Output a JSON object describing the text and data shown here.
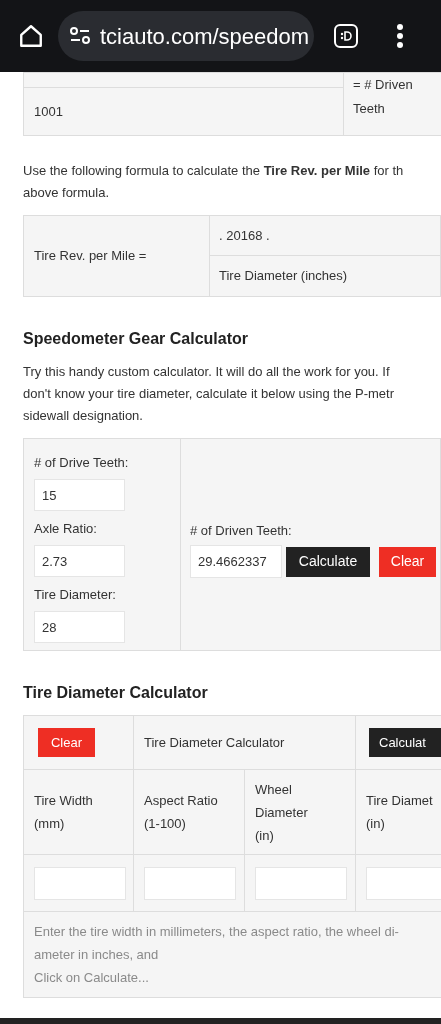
{
  "browser": {
    "url": "tciauto.com/speedom"
  },
  "top_table": {
    "value": "1001",
    "formula_part": "= # Driven Teeth"
  },
  "formula_intro": [
    "Use the following formula to calculate the **Tire Rev. per Mile** for th",
    "above formula."
  ],
  "formula_table": {
    "label": "Tire Rev. per Mile =",
    "numerator": ". 20168 .",
    "denominator": "Tire Diameter (inches)"
  },
  "speedometer": {
    "heading": "Speedometer Gear Calculator",
    "intro": [
      "Try this handy custom calculator. It will do all the work for you. If",
      "don't know your tire diameter, calculate it below using the P-metr",
      "sidewall designation."
    ],
    "fields": [
      {
        "label": "# of Drive Teeth:",
        "value": "15"
      },
      {
        "label": "Axle Ratio:",
        "value": "2.73"
      },
      {
        "label": "Tire Diameter:",
        "value": "28"
      }
    ],
    "result": {
      "label": "# of Driven Teeth:",
      "value": "29.4662337"
    },
    "buttons": [
      {
        "kind": "dark",
        "label": "Calculate"
      },
      {
        "kind": "red",
        "label": "Clear"
      }
    ]
  },
  "tire_calculator": {
    "heading": "Tire Diameter Calculator",
    "clear_button": "Clear",
    "caption": "Tire Diameter Calculator",
    "calculate_button": "Calculat",
    "columns": [
      [
        "Tire Width",
        "(mm)"
      ],
      [
        "Aspect Ratio",
        "(1-100)"
      ],
      [
        "Wheel",
        "Diameter",
        "(in)"
      ],
      [
        "Tire Diamet",
        "(in)"
      ]
    ],
    "note": [
      "Enter the tire width in millimeters, the aspect ratio, the wheel di-",
      "ameter in inches, and",
      "Click on Calculate..."
    ]
  }
}
